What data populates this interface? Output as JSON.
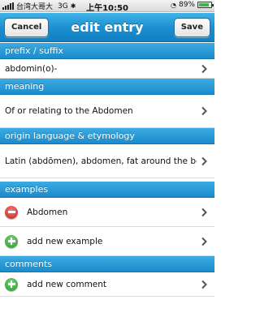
{
  "status_bar": {
    "carrier": "台湾大哥大",
    "network": "3G",
    "time": "上午10:50",
    "battery": "89%",
    "battery_level": 0.89
  },
  "nav": {
    "title": "edit entry",
    "cancel_label": "Cancel",
    "save_label": "Save"
  },
  "sections": {
    "prefix": {
      "header": "prefix / suffix",
      "value": "abdomin(o)-"
    },
    "meaning": {
      "header": "meaning",
      "value": "Of or relating to the Abdomen"
    },
    "origin": {
      "header": "origin language & etymology",
      "value": "Latin (abdōmen), abdomen, fat around the belly"
    },
    "examples": {
      "header": "examples",
      "items": [
        {
          "label": "Abdomen"
        }
      ],
      "add_label": "add new example"
    },
    "comments": {
      "header": "comments",
      "add_label": "add new comment"
    }
  }
}
